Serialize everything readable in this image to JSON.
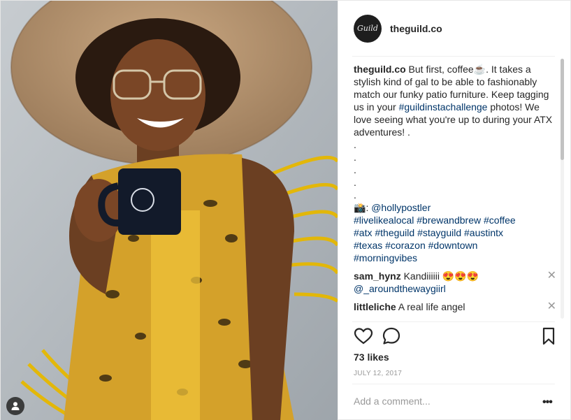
{
  "post": {
    "account": {
      "username": "theguild.co",
      "avatar_text": "Guild"
    },
    "caption": {
      "username": "theguild.co",
      "text_1": " But first, coffee☕. It takes a stylish kind of gal to be able to fashionably match our funky patio furniture. Keep tagging us in your ",
      "hashtag_challenge": "#guildinstachallenge",
      "text_2": " photos! We love seeing what you're up to during your ATX adventures! .",
      "dots": [
        ".",
        ".",
        ".",
        ".",
        "."
      ],
      "camera_emoji": "📸",
      "credit_sep": ": ",
      "credit": "@hollypostler",
      "hashtags_line1": "#livelikealocal #brewandbrew #coffee",
      "hashtags_line2": "#atx #theguild #stayguild #austintx",
      "hashtags_line3": "#texas #corazon #downtown",
      "hashtags_line4": "#morningvibes"
    },
    "comments": [
      {
        "username": "sam_hynz",
        "text": " Kandiiiiii 😍😍😍",
        "mention": "@_aroundthewaygiirl"
      },
      {
        "username": "littleliche",
        "text": " A real life angel"
      }
    ],
    "close_glyph": "✕",
    "likes": "73 likes",
    "date": "JULY 12, 2017",
    "add_comment_placeholder": "Add a comment...",
    "more_glyph": "•••"
  },
  "icons": {
    "like": "heart-icon",
    "comment": "comment-bubble-icon",
    "save": "bookmark-icon",
    "tag": "user-tag-icon",
    "more": "more-options-icon"
  },
  "colors": {
    "link": "#003569",
    "text": "#262626",
    "muted": "#999999",
    "divider": "#efefef"
  }
}
